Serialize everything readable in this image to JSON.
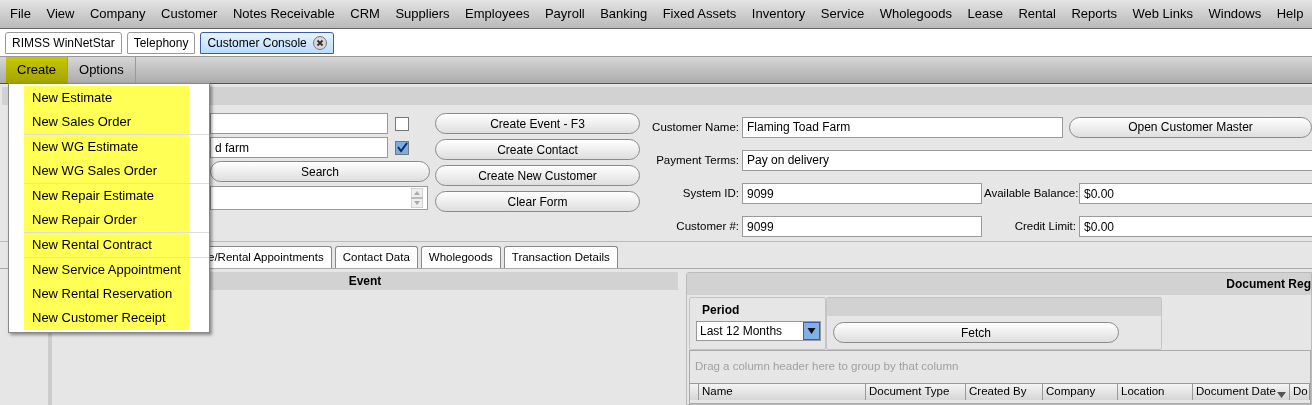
{
  "menubar": [
    "File",
    "View",
    "Company",
    "Customer",
    "Notes Receivable",
    "CRM",
    "Suppliers",
    "Employees",
    "Payroll",
    "Banking",
    "Fixed Assets",
    "Inventory",
    "Service",
    "Wholegoods",
    "Lease",
    "Rental",
    "Reports",
    "Web Links",
    "Windows",
    "Help"
  ],
  "doc_tabs": [
    {
      "label": "RIMSS WinNetStar",
      "selected": false,
      "closable": false
    },
    {
      "label": "Telephony",
      "selected": false,
      "closable": false
    },
    {
      "label": "Customer Console",
      "selected": true,
      "closable": true
    }
  ],
  "toolbar": [
    {
      "label": "Create",
      "selected": true
    },
    {
      "label": "Options",
      "selected": false
    }
  ],
  "create_menu": [
    [
      "New Estimate",
      "New Sales Order"
    ],
    [
      "New WG Estimate",
      "New WG Sales Order"
    ],
    [
      "New Repair Estimate",
      "New Repair Order"
    ],
    [
      "New Rental Contract"
    ],
    [
      "New Service Appointment",
      "New Rental Reservation",
      "New Customer Receipt"
    ]
  ],
  "search": {
    "rows": [
      {
        "value": "",
        "checked": false
      },
      {
        "value": "d farm",
        "checked": true
      }
    ],
    "button": "Search"
  },
  "actions": [
    "Create Event - F3",
    "Create Contact",
    "Create New Customer",
    "Clear Form"
  ],
  "customer": {
    "name_label": "Customer Name:",
    "name": "Flaming Toad Farm",
    "open_button": "Open Customer Master",
    "terms_label": "Payment Terms:",
    "terms": "Pay on delivery",
    "system_id_label": "System ID:",
    "system_id": "9099",
    "balance_label": "Available Balance:",
    "balance": "$0.00",
    "number_label": "Customer #:",
    "number": "9099",
    "credit_label": "Credit Limit:",
    "credit": "$0.00"
  },
  "detail_tabs": [
    "e/Rental Appointments",
    "Contact Data",
    "Wholegoods",
    "Transaction Details"
  ],
  "event_panel": {
    "header": "Event"
  },
  "documents_panel": {
    "header": "Document Reg",
    "period_label": "Period",
    "period": "Last 12 Months",
    "fetch": "Fetch",
    "group_hint": "Drag a column header here to group by that column",
    "columns": [
      {
        "label": "Name",
        "sorted": false
      },
      {
        "label": "Document Type",
        "sorted": false
      },
      {
        "label": "Created By",
        "sorted": false
      },
      {
        "label": "Company",
        "sorted": false
      },
      {
        "label": "Location",
        "sorted": false
      },
      {
        "label": "Document Date",
        "sorted": true
      },
      {
        "label": "Do"
      }
    ]
  }
}
